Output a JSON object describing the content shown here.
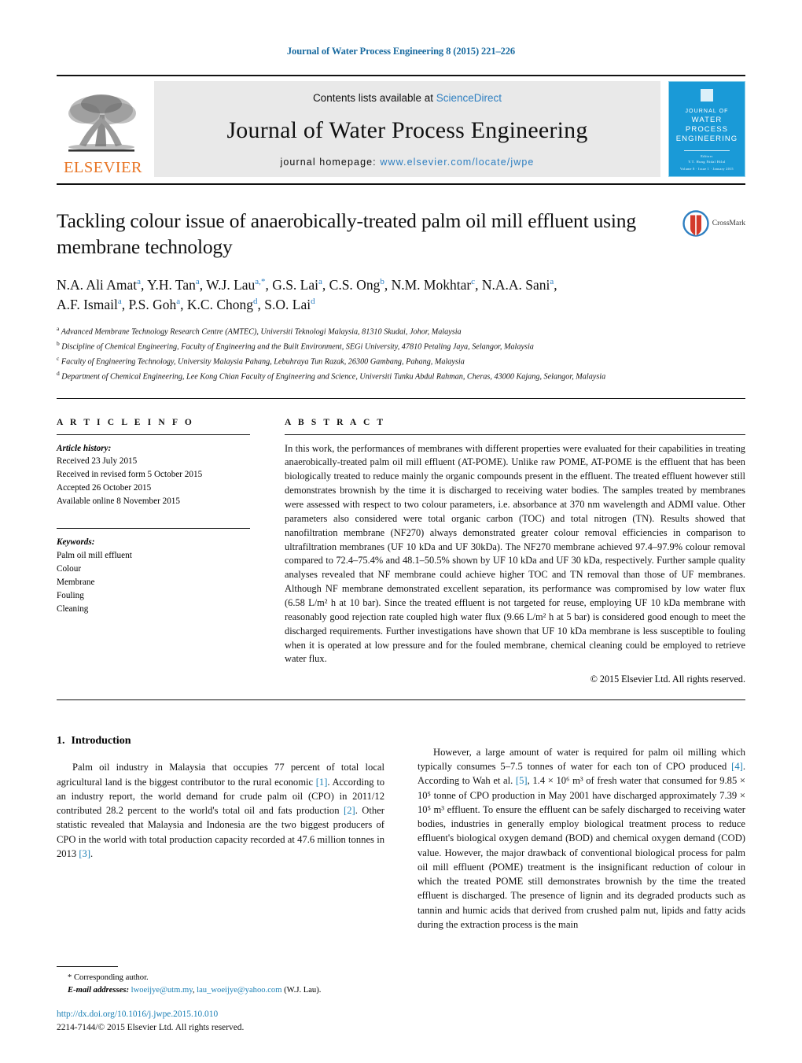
{
  "running_head": "Journal of Water Process Engineering 8 (2015) 221–226",
  "header": {
    "contents_prefix": "Contents lists available at ",
    "sciencedirect": "ScienceDirect",
    "journal_title": "Journal of Water Process Engineering",
    "homepage_prefix": "journal homepage: ",
    "homepage_url": "www.elsevier.com/locate/jwpe",
    "publisher": "ELSEVIER",
    "cover": {
      "line1": "JOURNAL OF",
      "line2": "WATER PROCESS",
      "line3": "ENGINEERING",
      "editors_label": "Editors",
      "editors": "Y.T. Hung   Nidal Hilal",
      "footer": "Volume 8 · Issue 1 · January 2015"
    },
    "accent_blue": "#2e7fc1",
    "elsevier_orange": "#E87424",
    "cover_blue": "#1a9ad7"
  },
  "article": {
    "title": "Tackling colour issue of anaerobically-treated palm oil mill effluent using membrane technology",
    "crossmark_label": "CrossMark",
    "authors_line1": "N.A. Ali Amat a, Y.H. Tan a, W.J. Lau a,*, G.S. Lai a, C.S. Ong b, N.M. Mokhtar c, N.A.A. Sani a,",
    "authors_line2": "A.F. Ismail a, P.S. Goh a, K.C. Chong d, S.O. Lai d",
    "affiliations": [
      {
        "mark": "a",
        "text": "Advanced Membrane Technology Research Centre (AMTEC), Universiti Teknologi Malaysia, 81310 Skudai, Johor, Malaysia"
      },
      {
        "mark": "b",
        "text": "Discipline of Chemical Engineering, Faculty of Engineering and the Built Environment, SEGi University, 47810 Petaling Jaya, Selangor, Malaysia"
      },
      {
        "mark": "c",
        "text": "Faculty of Engineering Technology, University Malaysia Pahang, Lebuhraya Tun Razak, 26300 Gambang, Pahang, Malaysia"
      },
      {
        "mark": "d",
        "text": "Department of Chemical Engineering, Lee Kong Chian Faculty of Engineering and Science, Universiti Tunku Abdul Rahman, Cheras, 43000 Kajang, Selangor, Malaysia"
      }
    ]
  },
  "article_info": {
    "heading": "A R T I C L E   I N F O",
    "history_label": "Article history:",
    "history": [
      "Received 23 July 2015",
      "Received in revised form 5 October 2015",
      "Accepted 26 October 2015",
      "Available online 8 November 2015"
    ],
    "keywords_label": "Keywords:",
    "keywords": [
      "Palm oil mill effluent",
      "Colour",
      "Membrane",
      "Fouling",
      "Cleaning"
    ]
  },
  "abstract": {
    "heading": "A B S T R A C T",
    "text": "In this work, the performances of membranes with different properties were evaluated for their capabilities in treating anaerobically-treated palm oil mill effluent (AT-POME). Unlike raw POME, AT-POME is the effluent that has been biologically treated to reduce mainly the organic compounds present in the effluent. The treated effluent however still demonstrates brownish by the time it is discharged to receiving water bodies. The samples treated by membranes were assessed with respect to two colour parameters, i.e. absorbance at 370 nm wavelength and ADMI value. Other parameters also considered were total organic carbon (TOC) and total nitrogen (TN). Results showed that nanofiltration membrane (NF270) always demonstrated greater colour removal efficiencies in comparison to ultrafiltration membranes (UF 10 kDa and UF 30kDa). The NF270 membrane achieved 97.4–97.9% colour removal compared to 72.4–75.4% and 48.1–50.5% shown by UF 10 kDa and UF 30 kDa, respectively. Further sample quality analyses revealed that NF membrane could achieve higher TOC and TN removal than those of UF membranes. Although NF membrane demonstrated excellent separation, its performance was compromised by low water flux (6.58 L/m² h at 10 bar). Since the treated effluent is not targeted for reuse, employing UF 10 kDa membrane with reasonably good rejection rate coupled high water flux (9.66 L/m² h at 5 bar) is considered good enough to meet the discharged requirements. Further investigations have shown that UF 10 kDa membrane is less susceptible to fouling when it is operated at low pressure and for the fouled membrane, chemical cleaning could be employed to retrieve water flux.",
    "copyright": "© 2015 Elsevier Ltd. All rights reserved."
  },
  "body": {
    "section_number": "1.",
    "section_title": "Introduction",
    "left_paragraph_parts": [
      "Palm oil industry in Malaysia that occupies 77 percent of total local agricultural land is the biggest contributor to the rural economic ",
      "[1]",
      ". According to an industry report, the world demand for crude palm oil (CPO) in 2011/12 contributed 28.2 percent to the world's total oil and fats production ",
      "[2]",
      ". Other statistic revealed that Malaysia and Indonesia are the two biggest producers of CPO in the world with total production capacity recorded at 47.6 million tonnes in 2013 ",
      "[3]",
      "."
    ],
    "right_paragraph_parts": [
      "However, a large amount of water is required for palm oil milling which typically consumes 5–7.5 tonnes of water for each ton of CPO produced ",
      "[4]",
      ". According to Wah et al. ",
      "[5]",
      ", 1.4 × 10⁶ m³ of fresh water that consumed for 9.85 × 10⁵ tonne of CPO production in May 2001 have discharged approximately 7.39 × 10⁵ m³ effluent. To ensure the effluent can be safely discharged to receiving water bodies, industries in generally employ biological treatment process to reduce effluent's biological oxygen demand (BOD) and chemical oxygen demand (COD) value. However, the major drawback of conventional biological process for palm oil mill effluent (POME) treatment is the insignificant reduction of colour in which the treated POME still demonstrates brownish by the time the treated effluent is discharged. The presence of lignin and its degraded products such as tannin and humic acids that derived from crushed palm nut, lipids and fatty acids during the extraction process is the main"
    ]
  },
  "footer": {
    "corresponding_marker": "*",
    "corresponding_text": "Corresponding author.",
    "email_label": "E-mail addresses:",
    "email1": "lwoeijye@utm.my",
    "email_sep": ", ",
    "email2": "lau_woeijye@yahoo.com",
    "email_suffix": " (W.J. Lau).",
    "doi": "http://dx.doi.org/10.1016/j.jwpe.2015.10.010",
    "issn_line": "2214-7144/© 2015 Elsevier Ltd. All rights reserved."
  }
}
